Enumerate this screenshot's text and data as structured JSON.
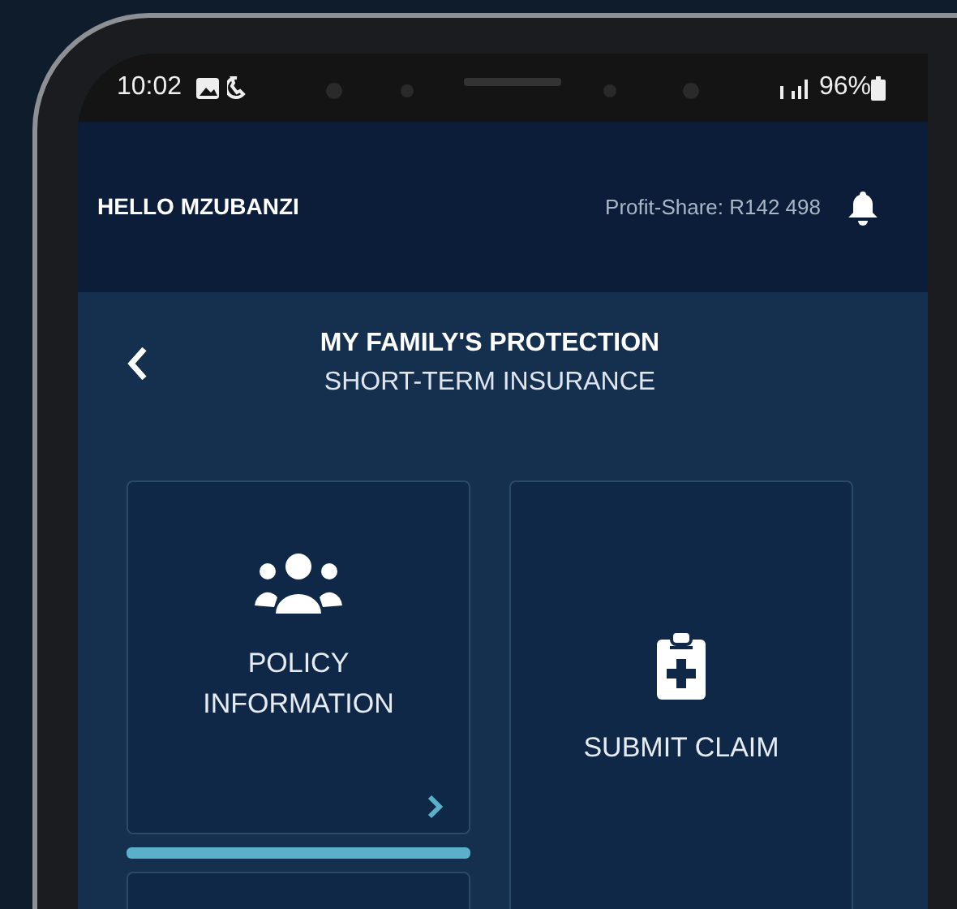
{
  "status_bar": {
    "time": "10:02",
    "battery": "96%"
  },
  "header": {
    "greeting": "HELLO MZUBANZI",
    "profit_share": "Profit-Share: R142 498"
  },
  "page": {
    "title": "MY FAMILY'S PROTECTION",
    "subtitle": "SHORT-TERM INSURANCE"
  },
  "tiles": [
    {
      "label": "POLICY INFORMATION",
      "kind": "policy",
      "selected": true
    },
    {
      "label": "SUBMIT CLAIM",
      "kind": "claim",
      "selected": false
    }
  ]
}
